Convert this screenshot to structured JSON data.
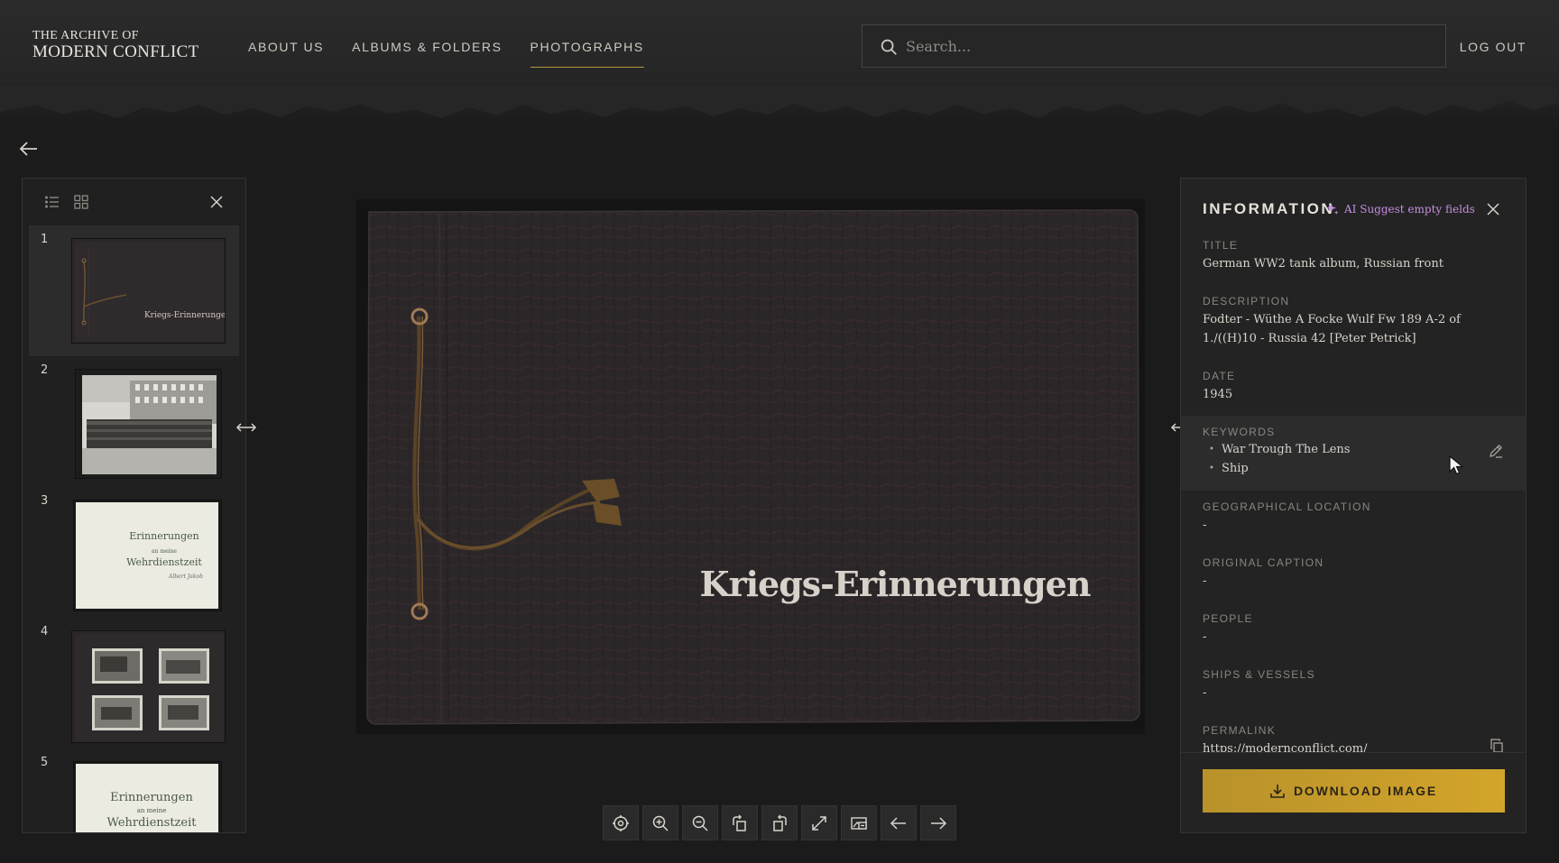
{
  "header": {
    "logo_line1": "THE ARCHIVE OF",
    "logo_line2": "MODERN CONFLICT",
    "nav": [
      {
        "label": "ABOUT US"
      },
      {
        "label": "ALBUMS & FOLDERS"
      },
      {
        "label": "PHOTOGRAPHS",
        "active": true
      }
    ],
    "search_placeholder": "Search...",
    "logout_label": "LOG OUT"
  },
  "thumbnails": [
    {
      "number": "1",
      "cover_text": "Kriegs-Erinnerungen",
      "selected": true
    },
    {
      "number": "2"
    },
    {
      "number": "3",
      "text_l1": "Erinnerungen",
      "text_l2": "an meine",
      "text_l3": "Wehrdienstzeit",
      "signature": "Albert Jakob"
    },
    {
      "number": "4"
    },
    {
      "number": "5",
      "text_l1": "Erinnerungen",
      "text_l2": "an meine",
      "text_l3": "Wehrdienstzeit"
    }
  ],
  "main_image": {
    "cover_text": "Kriegs-Erinnerungen"
  },
  "info": {
    "title": "INFORMATION",
    "ai_label": "AI Suggest empty fields",
    "fields": {
      "title": {
        "label": "TITLE",
        "value": "German WW2 tank album, Russian front"
      },
      "description": {
        "label": "DESCRIPTION",
        "value": "Fodter - Wüthe A Focke Wulf Fw 189 A-2 of 1./((H)10 - Russia 42 [Peter Petrick]"
      },
      "date": {
        "label": "DATE",
        "value": "1945"
      },
      "keywords": {
        "label": "KEYWORDS",
        "values": [
          "War Trough The Lens",
          "Ship"
        ]
      },
      "geo": {
        "label": "GEOGRAPHICAL LOCATION",
        "value": "-"
      },
      "caption": {
        "label": "ORIGINAL CAPTION",
        "value": "-"
      },
      "people": {
        "label": "PEOPLE",
        "value": "-"
      },
      "ships": {
        "label": "SHIPS & VESSELS",
        "value": "-"
      },
      "permalink": {
        "label": "PERMALINK",
        "value": "https://modernconflict.com/"
      }
    },
    "download_label": "DOWNLOAD IMAGE"
  },
  "colors": {
    "accent_gold": "#c79c2a",
    "ai_purple": "#c58ee0",
    "background": "#1b1b1b"
  }
}
